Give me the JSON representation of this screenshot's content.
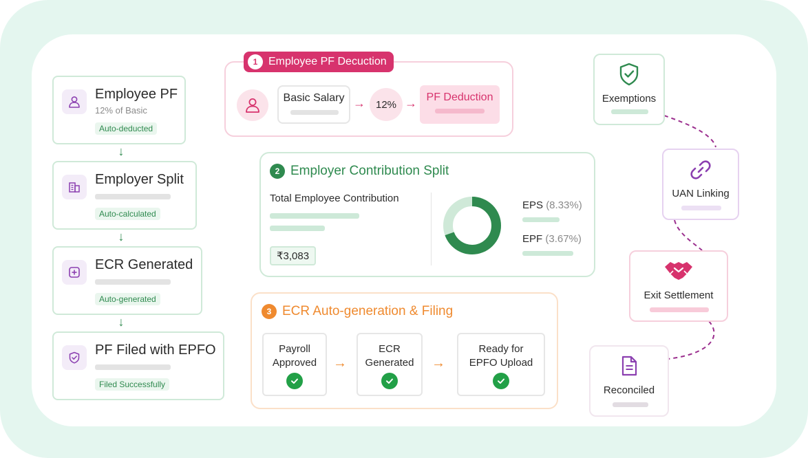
{
  "left_steps": [
    {
      "title": "Employee PF",
      "subtitle": "12% of Basic",
      "badge": "Auto-deducted",
      "icon": "user-icon"
    },
    {
      "title": "Employer Split",
      "subtitle": "",
      "badge": "Auto-calculated",
      "icon": "building-icon"
    },
    {
      "title": "ECR Generated",
      "subtitle": "",
      "badge": "Auto-generated",
      "icon": "plus-square-icon"
    },
    {
      "title": "PF Filed with EPFO",
      "subtitle": "",
      "badge": "Filed Successfully",
      "icon": "shield-check-icon"
    }
  ],
  "section1": {
    "number": "1",
    "title": "Employee PF Decuction",
    "basic_salary": "Basic Salary",
    "percent": "12%",
    "pf_deduction": "PF Deduction"
  },
  "section2": {
    "number": "2",
    "title": "Employer Contribution Split",
    "total_label": "Total Employee Contribution",
    "amount": "₹3,083",
    "legend": [
      {
        "name": "EPS",
        "value": "(8.33%)"
      },
      {
        "name": "EPF",
        "value": "(3.67%)"
      }
    ],
    "donut_fraction": 0.694,
    "colors": {
      "primary": "#2f8a4f",
      "secondary": "#cfe9d8"
    }
  },
  "section3": {
    "number": "3",
    "title": "ECR Auto-generation & Filing",
    "steps": [
      {
        "line1": "Payroll",
        "line2": "Approved"
      },
      {
        "line1": "ECR",
        "line2": "Generated"
      },
      {
        "line1": "Ready for",
        "line2": "EPFO Upload"
      }
    ]
  },
  "right_nodes": [
    {
      "label": "Exemptions",
      "icon": "shield-check-icon"
    },
    {
      "label": "UAN Linking",
      "icon": "link-icon"
    },
    {
      "label": "Exit Settlement",
      "icon": "handshake-icon"
    },
    {
      "label": "Reconciled",
      "icon": "document-icon"
    }
  ],
  "colors": {
    "green": "#2f8a4f",
    "pink": "#d7336d",
    "orange": "#ef8a2f",
    "purple": "#8b3fb0"
  }
}
